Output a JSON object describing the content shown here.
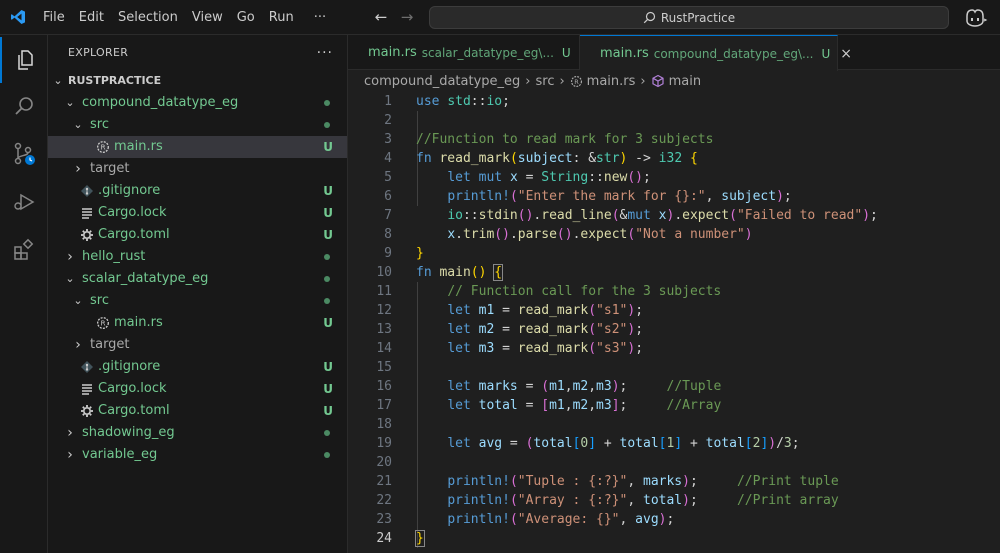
{
  "menu": [
    "File",
    "Edit",
    "Selection",
    "View",
    "Go",
    "Run",
    "···"
  ],
  "search": {
    "text": "RustPractice"
  },
  "sidebar": {
    "title": "EXPLORER",
    "more": "···",
    "root": "RUSTPRACTICE",
    "tree": [
      {
        "label": "compound_datatype_eg",
        "kind": "folder",
        "open": true,
        "depth": 1,
        "status": "dot"
      },
      {
        "label": "src",
        "kind": "folder",
        "open": true,
        "depth": 2,
        "status": "dot"
      },
      {
        "label": "main.rs",
        "kind": "rust",
        "depth": 3,
        "status": "U",
        "selected": true
      },
      {
        "label": "target",
        "kind": "folder",
        "open": false,
        "depth": 2,
        "status": ""
      },
      {
        "label": ".gitignore",
        "kind": "gitignore",
        "depth": 2,
        "status": "U"
      },
      {
        "label": "Cargo.lock",
        "kind": "lock",
        "depth": 2,
        "status": "U"
      },
      {
        "label": "Cargo.toml",
        "kind": "toml",
        "depth": 2,
        "status": "U"
      },
      {
        "label": "hello_rust",
        "kind": "folder",
        "open": false,
        "depth": 1,
        "status": "dot"
      },
      {
        "label": "scalar_datatype_eg",
        "kind": "folder",
        "open": true,
        "depth": 1,
        "status": "dot"
      },
      {
        "label": "src",
        "kind": "folder",
        "open": true,
        "depth": 2,
        "status": "dot"
      },
      {
        "label": "main.rs",
        "kind": "rust",
        "depth": 3,
        "status": "U"
      },
      {
        "label": "target",
        "kind": "folder",
        "open": false,
        "depth": 2,
        "status": ""
      },
      {
        "label": ".gitignore",
        "kind": "gitignore",
        "depth": 2,
        "status": "U"
      },
      {
        "label": "Cargo.lock",
        "kind": "lock",
        "depth": 2,
        "status": "U"
      },
      {
        "label": "Cargo.toml",
        "kind": "toml",
        "depth": 2,
        "status": "U"
      },
      {
        "label": "shadowing_eg",
        "kind": "folder",
        "open": false,
        "depth": 1,
        "status": "dot"
      },
      {
        "label": "variable_eg",
        "kind": "folder",
        "open": false,
        "depth": 1,
        "status": "dot"
      }
    ]
  },
  "tabs": [
    {
      "name": "main.rs",
      "desc": "scalar_datatype_eg\\...",
      "status": "U",
      "active": false
    },
    {
      "name": "main.rs",
      "desc": "compound_datatype_eg\\...",
      "status": "U",
      "active": true,
      "close": "×"
    }
  ],
  "breadcrumb": [
    "compound_datatype_eg",
    "src",
    "main.rs",
    "main"
  ],
  "colors": {
    "accent": "#0078d4",
    "untracked": "#73c991",
    "selected_row": "#37373d"
  },
  "code": [
    [
      [
        "kw",
        "use"
      ],
      [
        "pu",
        " "
      ],
      [
        "ty",
        "std"
      ],
      [
        "pu",
        "::"
      ],
      [
        "ty",
        "io"
      ],
      [
        "pu",
        ";"
      ]
    ],
    [],
    [
      [
        "cm",
        "//Function to read mark for 3 subjects"
      ]
    ],
    [
      [
        "kw",
        "fn"
      ],
      [
        "pu",
        " "
      ],
      [
        "fn",
        "read_mark"
      ],
      [
        "br1",
        "("
      ],
      [
        "var",
        "subject"
      ],
      [
        "pu",
        ": &"
      ],
      [
        "ty",
        "str"
      ],
      [
        "br1",
        ")"
      ],
      [
        "pu",
        " -> "
      ],
      [
        "ty",
        "i32"
      ],
      [
        "pu",
        " "
      ],
      [
        "br1",
        "{"
      ]
    ],
    [
      [
        "pu",
        "    "
      ],
      [
        "kw",
        "let"
      ],
      [
        "pu",
        " "
      ],
      [
        "kw",
        "mut"
      ],
      [
        "pu",
        " "
      ],
      [
        "var",
        "x"
      ],
      [
        "pu",
        " = "
      ],
      [
        "ty",
        "String"
      ],
      [
        "pu",
        "::"
      ],
      [
        "fn",
        "new"
      ],
      [
        "br2",
        "()"
      ],
      [
        "pu",
        ";"
      ]
    ],
    [
      [
        "pu",
        "    "
      ],
      [
        "mac",
        "println!"
      ],
      [
        "br2",
        "("
      ],
      [
        "str",
        "\"Enter the mark for {}:\""
      ],
      [
        "pu",
        ", "
      ],
      [
        "var",
        "subject"
      ],
      [
        "br2",
        ")"
      ],
      [
        "pu",
        ";"
      ]
    ],
    [
      [
        "pu",
        "    "
      ],
      [
        "ty",
        "io"
      ],
      [
        "pu",
        "::"
      ],
      [
        "fn",
        "stdin"
      ],
      [
        "br2",
        "()"
      ],
      [
        "pu",
        "."
      ],
      [
        "fn",
        "read_line"
      ],
      [
        "br2",
        "("
      ],
      [
        "pu",
        "&"
      ],
      [
        "kw",
        "mut"
      ],
      [
        "pu",
        " "
      ],
      [
        "var",
        "x"
      ],
      [
        "br2",
        ")"
      ],
      [
        "pu",
        "."
      ],
      [
        "fn",
        "expect"
      ],
      [
        "br2",
        "("
      ],
      [
        "str",
        "\"Failed to read\""
      ],
      [
        "br2",
        ")"
      ],
      [
        "pu",
        ";"
      ]
    ],
    [
      [
        "pu",
        "    "
      ],
      [
        "var",
        "x"
      ],
      [
        "pu",
        "."
      ],
      [
        "fn",
        "trim"
      ],
      [
        "br2",
        "()"
      ],
      [
        "pu",
        "."
      ],
      [
        "fn",
        "parse"
      ],
      [
        "br2",
        "()"
      ],
      [
        "pu",
        "."
      ],
      [
        "fn",
        "expect"
      ],
      [
        "br2",
        "("
      ],
      [
        "str",
        "\"Not a number\""
      ],
      [
        "br2",
        ")"
      ]
    ],
    [
      [
        "br1",
        "}"
      ]
    ],
    [
      [
        "kw",
        "fn"
      ],
      [
        "pu",
        " "
      ],
      [
        "fn",
        "main"
      ],
      [
        "br1",
        "()"
      ],
      [
        "pu",
        " "
      ],
      [
        "br1",
        "{"
      ]
    ],
    [
      [
        "pu",
        "    "
      ],
      [
        "cm",
        "// Function call for the 3 subjects"
      ]
    ],
    [
      [
        "pu",
        "    "
      ],
      [
        "kw",
        "let"
      ],
      [
        "pu",
        " "
      ],
      [
        "var",
        "m1"
      ],
      [
        "pu",
        " = "
      ],
      [
        "fn",
        "read_mark"
      ],
      [
        "br2",
        "("
      ],
      [
        "str",
        "\"s1\""
      ],
      [
        "br2",
        ")"
      ],
      [
        "pu",
        ";"
      ]
    ],
    [
      [
        "pu",
        "    "
      ],
      [
        "kw",
        "let"
      ],
      [
        "pu",
        " "
      ],
      [
        "var",
        "m2"
      ],
      [
        "pu",
        " = "
      ],
      [
        "fn",
        "read_mark"
      ],
      [
        "br2",
        "("
      ],
      [
        "str",
        "\"s2\""
      ],
      [
        "br2",
        ")"
      ],
      [
        "pu",
        ";"
      ]
    ],
    [
      [
        "pu",
        "    "
      ],
      [
        "kw",
        "let"
      ],
      [
        "pu",
        " "
      ],
      [
        "var",
        "m3"
      ],
      [
        "pu",
        " = "
      ],
      [
        "fn",
        "read_mark"
      ],
      [
        "br2",
        "("
      ],
      [
        "str",
        "\"s3\""
      ],
      [
        "br2",
        ")"
      ],
      [
        "pu",
        ";"
      ]
    ],
    [],
    [
      [
        "pu",
        "    "
      ],
      [
        "kw",
        "let"
      ],
      [
        "pu",
        " "
      ],
      [
        "var",
        "marks"
      ],
      [
        "pu",
        " = "
      ],
      [
        "br2",
        "("
      ],
      [
        "var",
        "m1"
      ],
      [
        "pu",
        ","
      ],
      [
        "var",
        "m2"
      ],
      [
        "pu",
        ","
      ],
      [
        "var",
        "m3"
      ],
      [
        "br2",
        ")"
      ],
      [
        "pu",
        ";     "
      ],
      [
        "cm",
        "//Tuple"
      ]
    ],
    [
      [
        "pu",
        "    "
      ],
      [
        "kw",
        "let"
      ],
      [
        "pu",
        " "
      ],
      [
        "var",
        "total"
      ],
      [
        "pu",
        " = "
      ],
      [
        "br2",
        "["
      ],
      [
        "var",
        "m1"
      ],
      [
        "pu",
        ","
      ],
      [
        "var",
        "m2"
      ],
      [
        "pu",
        ","
      ],
      [
        "var",
        "m3"
      ],
      [
        "br2",
        "]"
      ],
      [
        "pu",
        ";     "
      ],
      [
        "cm",
        "//Array"
      ]
    ],
    [],
    [
      [
        "pu",
        "    "
      ],
      [
        "kw",
        "let"
      ],
      [
        "pu",
        " "
      ],
      [
        "var",
        "avg"
      ],
      [
        "pu",
        " = "
      ],
      [
        "br2",
        "("
      ],
      [
        "var",
        "total"
      ],
      [
        "br3",
        "["
      ],
      [
        "num",
        "0"
      ],
      [
        "br3",
        "]"
      ],
      [
        "pu",
        " + "
      ],
      [
        "var",
        "total"
      ],
      [
        "br3",
        "["
      ],
      [
        "num",
        "1"
      ],
      [
        "br3",
        "]"
      ],
      [
        "pu",
        " + "
      ],
      [
        "var",
        "total"
      ],
      [
        "br3",
        "["
      ],
      [
        "num",
        "2"
      ],
      [
        "br3",
        "]"
      ],
      [
        "br2",
        ")"
      ],
      [
        "pu",
        "/"
      ],
      [
        "num",
        "3"
      ],
      [
        "pu",
        ";"
      ]
    ],
    [],
    [
      [
        "pu",
        "    "
      ],
      [
        "mac",
        "println!"
      ],
      [
        "br2",
        "("
      ],
      [
        "str",
        "\"Tuple : {:?}\""
      ],
      [
        "pu",
        ", "
      ],
      [
        "var",
        "marks"
      ],
      [
        "br2",
        ")"
      ],
      [
        "pu",
        ";     "
      ],
      [
        "cm",
        "//Print tuple"
      ]
    ],
    [
      [
        "pu",
        "    "
      ],
      [
        "mac",
        "println!"
      ],
      [
        "br2",
        "("
      ],
      [
        "str",
        "\"Array : {:?}\""
      ],
      [
        "pu",
        ", "
      ],
      [
        "var",
        "total"
      ],
      [
        "br2",
        ")"
      ],
      [
        "pu",
        ";     "
      ],
      [
        "cm",
        "//Print array"
      ]
    ],
    [
      [
        "pu",
        "    "
      ],
      [
        "mac",
        "println!"
      ],
      [
        "br2",
        "("
      ],
      [
        "str",
        "\"Average: {}\""
      ],
      [
        "pu",
        ", "
      ],
      [
        "var",
        "avg"
      ],
      [
        "br2",
        ")"
      ],
      [
        "pu",
        ";"
      ]
    ],
    [
      [
        "br1",
        "}"
      ]
    ]
  ],
  "current_line": 24
}
